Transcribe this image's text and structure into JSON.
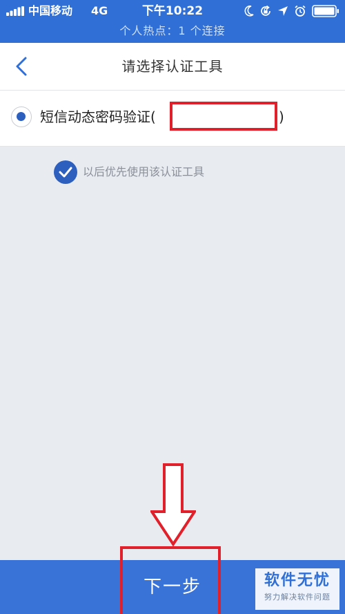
{
  "status_bar": {
    "carrier": "中国移动",
    "network": "4G",
    "time": "下午10:22",
    "hotspot_text": "个人热点：1 个连接",
    "icons": [
      "signal-icon",
      "moon-icon",
      "orientation-lock-icon",
      "location-icon",
      "alarm-icon",
      "battery-icon"
    ]
  },
  "nav": {
    "title": "请选择认证工具",
    "back_icon": "chevron-left-icon"
  },
  "option": {
    "label": "短信动态密码验证(",
    "paren_close": ")",
    "selected": true
  },
  "remember": {
    "label": "以后优先使用该认证工具",
    "checked": true
  },
  "footer": {
    "next_label": "下一步"
  },
  "watermark": {
    "title": "软件无忧",
    "subtitle": "努力解决软件问题"
  },
  "colors": {
    "status_bar": "#2f6fd6",
    "accent": "#2d5fbf",
    "bottom_button": "#3a73d8",
    "annotation_red": "#e0202a",
    "background": "#e8ebf0"
  }
}
